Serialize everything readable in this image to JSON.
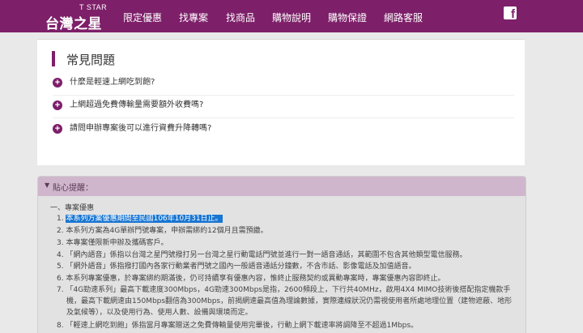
{
  "brand": {
    "small": "T STAR",
    "name": "台灣之星"
  },
  "nav": [
    "限定優惠",
    "找專案",
    "找商品",
    "購物說明",
    "購物保證",
    "網路客服"
  ],
  "social": {
    "icon": "facebook-icon",
    "glyph": "f"
  },
  "faq": {
    "title": "常見問題",
    "items": [
      "什麼是輕速上網吃到飽?",
      "上網超過免費傳輸量需要額外收費嗎?",
      "請問申辦專案後可以進行資費升降轉嗎?"
    ]
  },
  "notice": {
    "header": "貼心提醒：",
    "section": "一、專案優惠",
    "lines": [
      {
        "num": "1.",
        "text": "本系列方案優惠期間至民國106年10月31日止。"
      },
      {
        "num": "2.",
        "text": "本系列方案為4G單辦門號專案，申辦需綁約12個月且需預繳。"
      },
      {
        "num": "3.",
        "text": "本專案僅限新申辦及攜碼客戶。"
      },
      {
        "num": "4.",
        "text": "「網內語音」係指以台灣之星門號撥打另一台灣之星行動電話門號並進行一對一語音通話，其範圍不包含其他類型電信服務。"
      },
      {
        "num": "5.",
        "text": "「網外語音」係指撥打國內各家行動業者門號之國內一般語音通話分鐘數，不含市話、影像電話及加值語音。"
      },
      {
        "num": "6.",
        "text": "本系列專案優惠，於專案綁約期滿後，仍可持續享有優惠內容，惟終止服務契約或異動專案時，專案優惠內容即終止。"
      },
      {
        "num": "7.",
        "text": "「4G勁速系列」最高下載速度300Mbps，4G勁速300Mbps是指，2600頻段上，下行共40MHz，啟用4X4 MIMO技術後搭配指定機款手"
      },
      {
        "num": "",
        "text": "機，最高下載網速由150Mbps翻倍為300Mbps，前揭網速最高值為理論數據，實際連線狀況仍需視使用者所處地理位置（建物遮蔽、地形"
      },
      {
        "num": "",
        "text": "及氣候等），以及使用行為、使用人數、設備與環境而定。"
      },
      {
        "num": "8.",
        "text": "「輕速上網吃到飽」係指當月專案贈送之免費傳輸量使用完畢後，行動上網下載速率將調降至不超過1Mbps。"
      }
    ]
  },
  "colors": {
    "brand": "#7d1f69",
    "notice_header": "#cfb6cc",
    "highlight": "#1976d2"
  }
}
